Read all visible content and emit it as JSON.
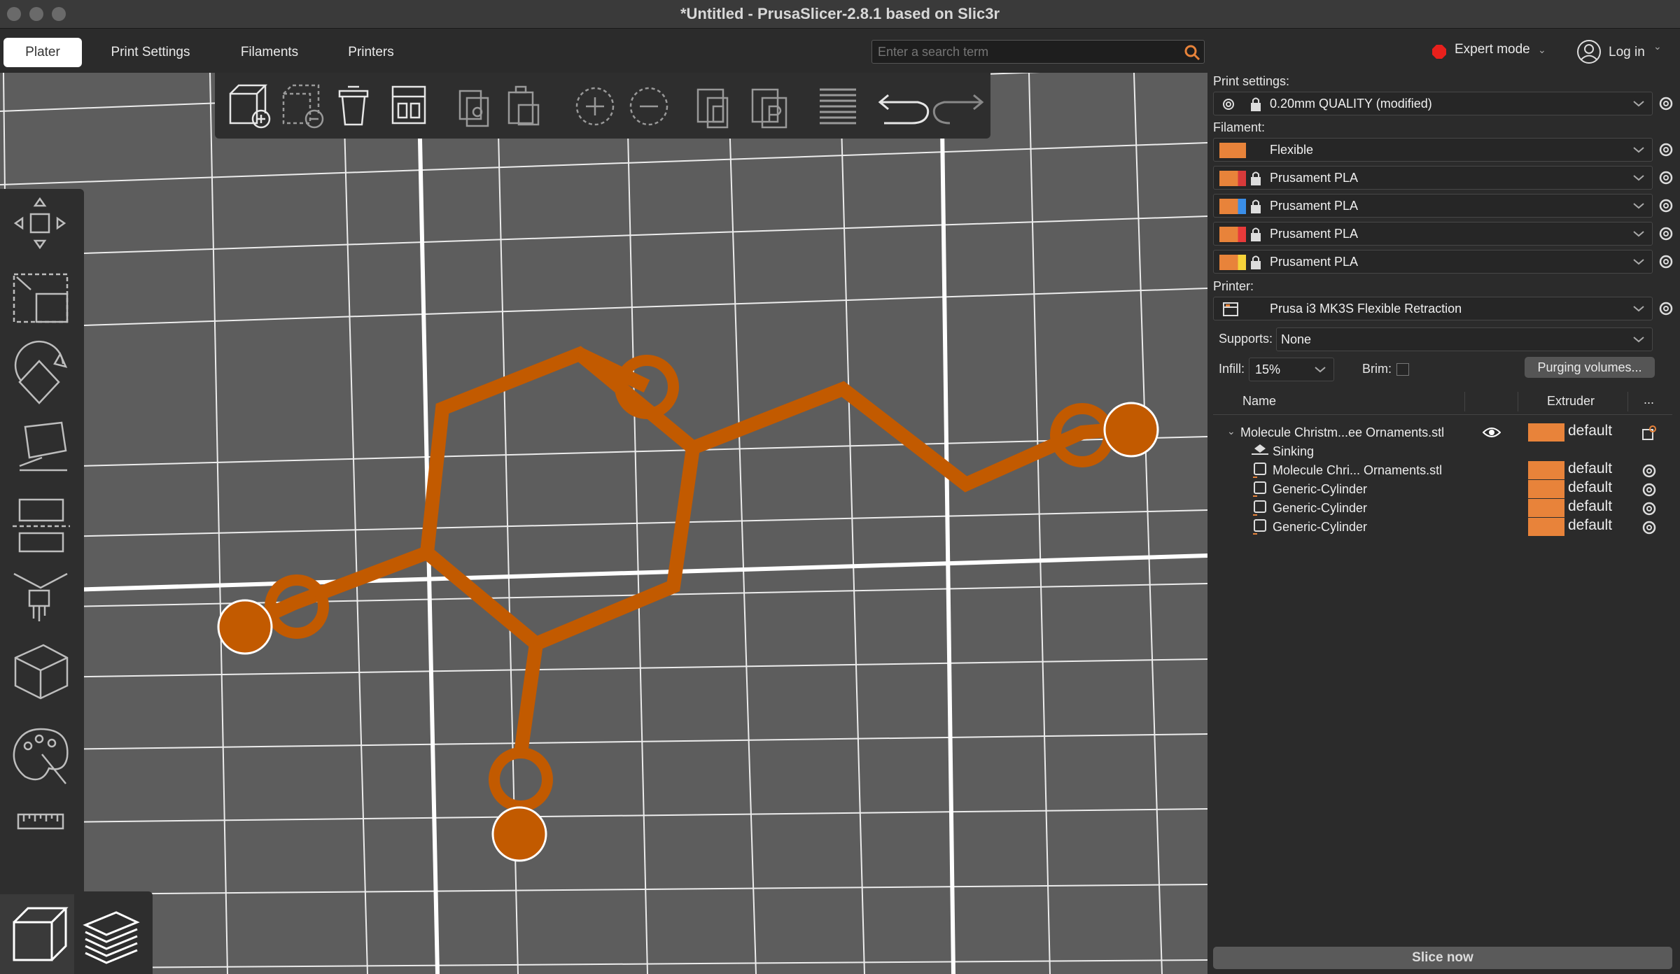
{
  "window": {
    "title": "*Untitled - PrusaSlicer-2.8.1 based on Slic3r"
  },
  "tabs": [
    {
      "label": "Plater",
      "active": true
    },
    {
      "label": "Print Settings",
      "active": false
    },
    {
      "label": "Filaments",
      "active": false
    },
    {
      "label": "Printers",
      "active": false
    }
  ],
  "search": {
    "placeholder": "Enter a search term"
  },
  "mode": {
    "label": "Expert mode",
    "color": "#e8201c"
  },
  "login": {
    "label": "Log in"
  },
  "print_settings": {
    "label": "Print settings:",
    "value": "0.20mm QUALITY (modified)"
  },
  "filament": {
    "label": "Filament:",
    "items": [
      {
        "name": "Flexible",
        "color": "#e8833a",
        "color2": "#e8833a",
        "locked": false
      },
      {
        "name": "Prusament PLA",
        "color": "#e8833a",
        "color2": "#d83a3a",
        "locked": true
      },
      {
        "name": "Prusament PLA",
        "color": "#e8833a",
        "color2": "#3a8ee8",
        "locked": true
      },
      {
        "name": "Prusament PLA",
        "color": "#e8833a",
        "color2": "#e83a3a",
        "locked": true
      },
      {
        "name": "Prusament PLA",
        "color": "#e8833a",
        "color2": "#f5d23a",
        "locked": true
      }
    ]
  },
  "printer": {
    "label": "Printer:",
    "value": "Prusa i3 MK3S Flexible Retraction"
  },
  "supports": {
    "label": "Supports:",
    "value": "None"
  },
  "infill": {
    "label": "Infill:",
    "value": "15%"
  },
  "brim": {
    "label": "Brim:",
    "checked": false
  },
  "purging": {
    "label": "Purging volumes..."
  },
  "object_list": {
    "headers": {
      "name": "Name",
      "extruder": "Extruder",
      "more": "..."
    },
    "rows": [
      {
        "name": "Molecule Christm...ee Ornaments.stl",
        "extruder": "default",
        "type": "object"
      },
      {
        "name": "Sinking",
        "extruder": "",
        "type": "info"
      },
      {
        "name": "Molecule Chri... Ornaments.stl",
        "extruder": "default",
        "type": "part"
      },
      {
        "name": "Generic-Cylinder",
        "extruder": "default",
        "type": "part"
      },
      {
        "name": "Generic-Cylinder",
        "extruder": "default",
        "type": "part"
      },
      {
        "name": "Generic-Cylinder",
        "extruder": "default",
        "type": "part"
      }
    ]
  },
  "slice": {
    "label": "Slice now"
  },
  "colors": {
    "model": "#c25a00",
    "accent": "#e8833a"
  },
  "icons": {
    "toolbar": [
      "add-icon",
      "delete-icon",
      "delete-all-icon",
      "arrange-icon",
      "copy-icon",
      "paste-icon",
      "add-instance-icon",
      "remove-instance-icon",
      "split-objects-icon",
      "split-parts-icon",
      "variable-layer-height-icon",
      "undo-icon",
      "redo-icon"
    ],
    "left": [
      "move-icon",
      "scale-icon",
      "rotate-icon",
      "place-on-face-icon",
      "cut-icon",
      "paint-supports-icon",
      "measure-icon",
      "paint-color-icon",
      "ruler-icon"
    ],
    "view": [
      "3d-view-icon",
      "preview-icon"
    ]
  }
}
